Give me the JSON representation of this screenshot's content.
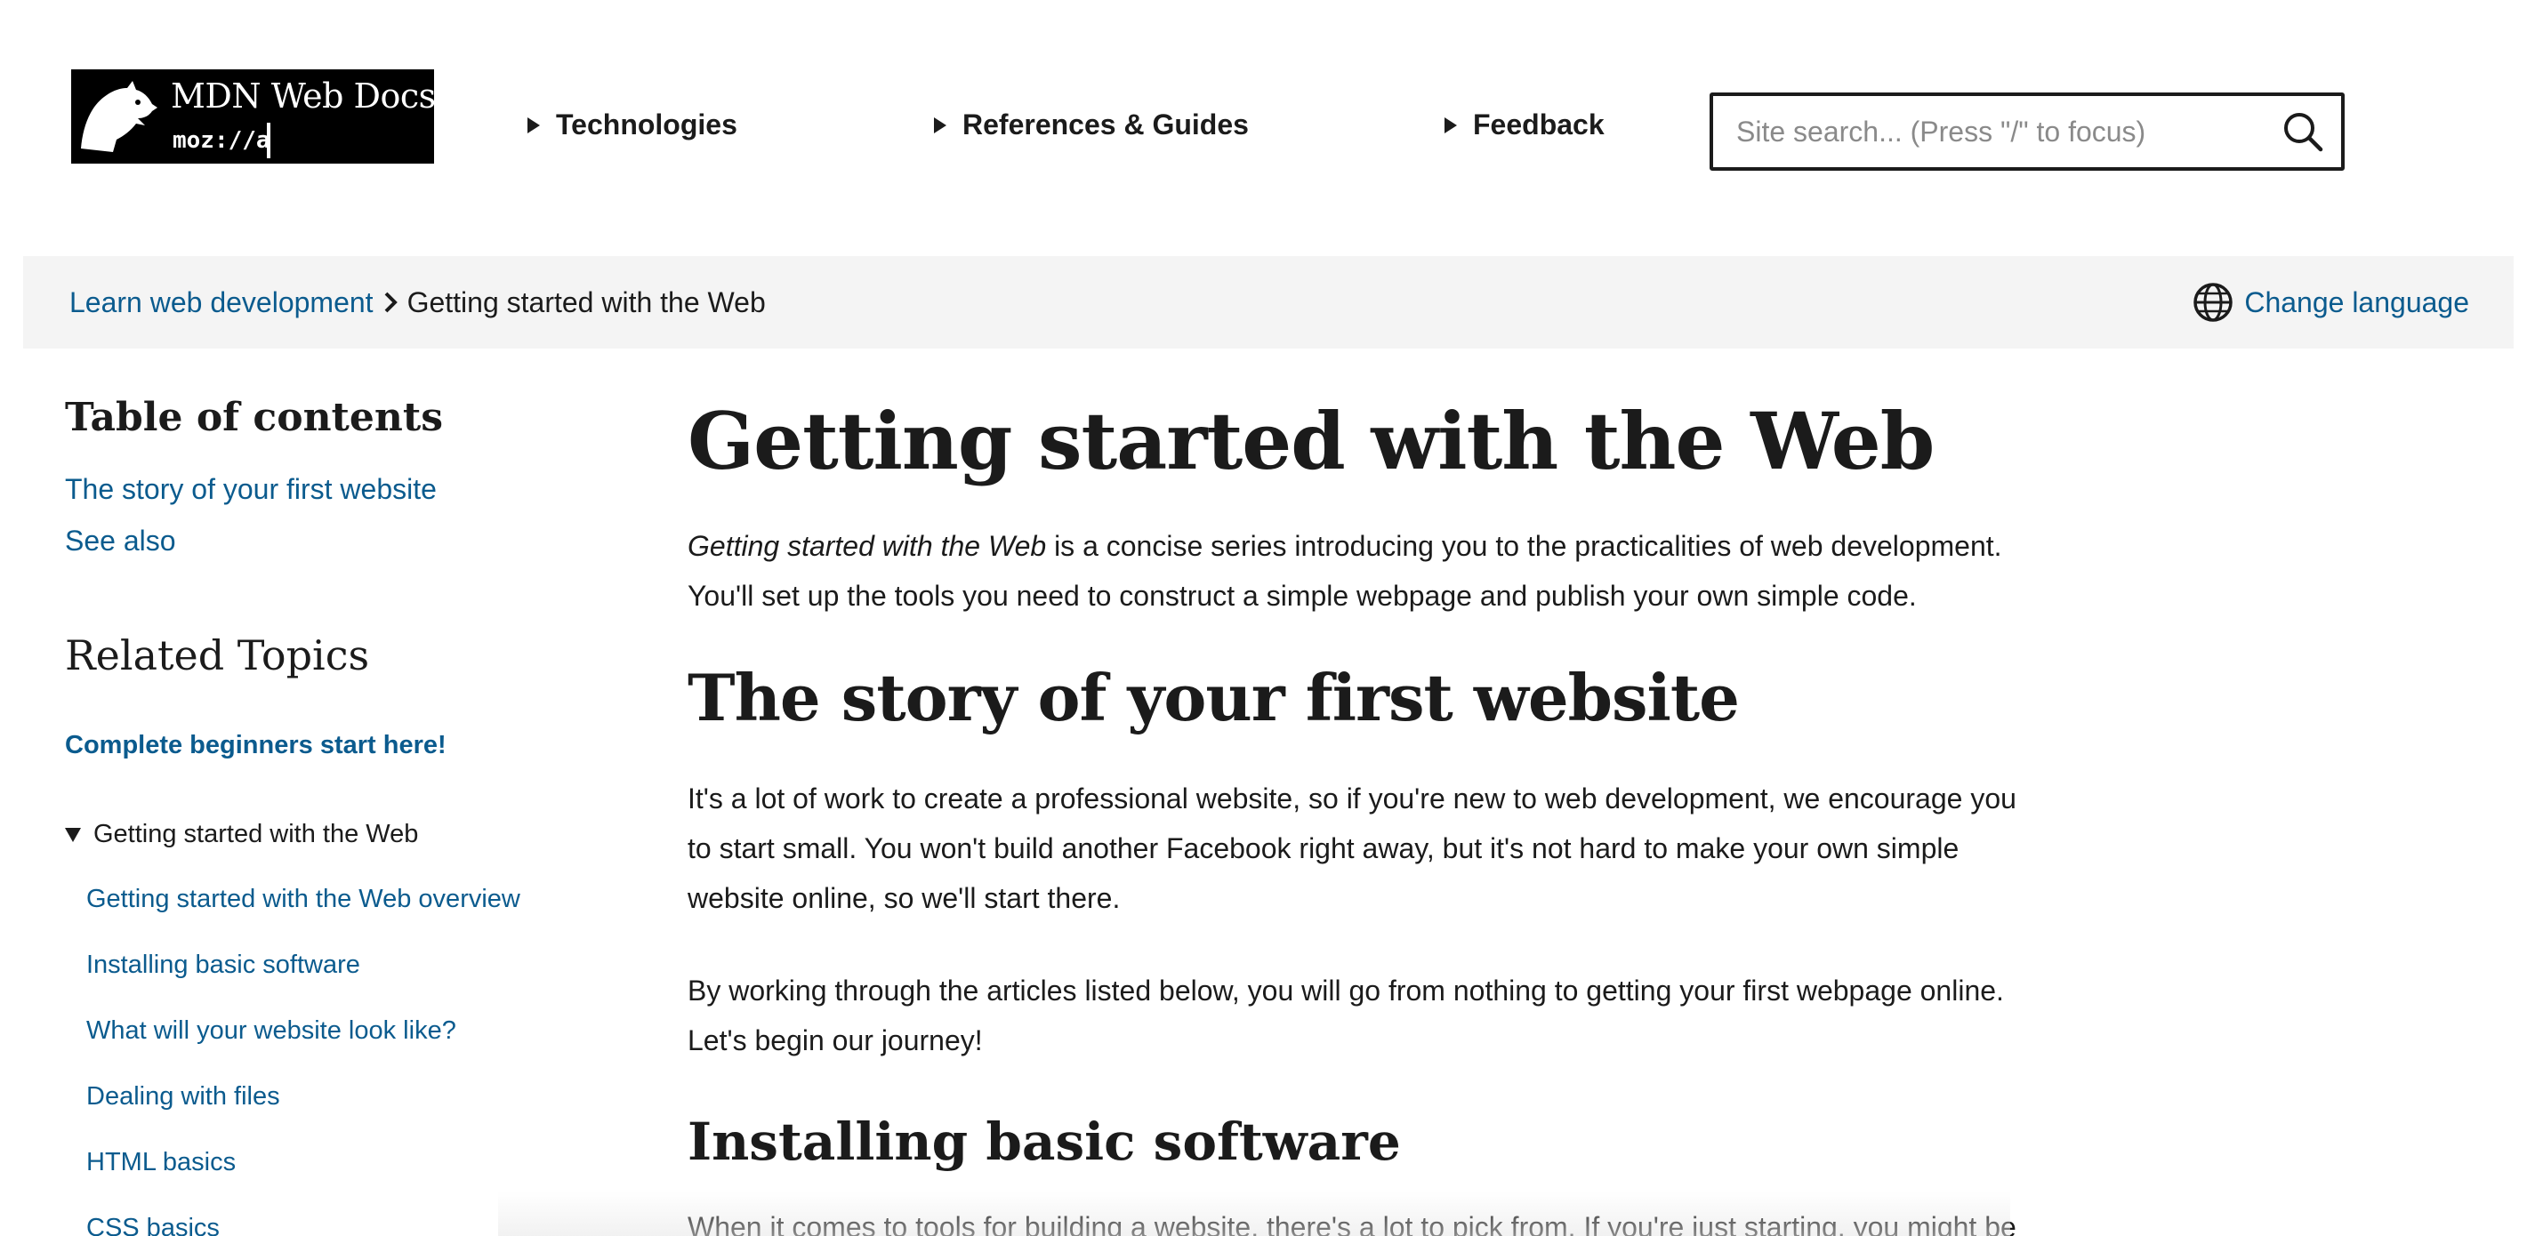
{
  "header": {
    "logo": {
      "title": "MDN Web Docs",
      "sub": "moz://a"
    },
    "nav": [
      {
        "label": "Technologies"
      },
      {
        "label": "References & Guides"
      },
      {
        "label": "Feedback"
      }
    ],
    "search": {
      "placeholder": "Site search... (Press \"/\" to focus)",
      "value": ""
    }
  },
  "breadcrumb": {
    "parent": "Learn web development",
    "current": "Getting started with the Web",
    "change_language": "Change language"
  },
  "sidebar": {
    "toc_title": "Table of contents",
    "toc": [
      {
        "label": "The story of your first website"
      },
      {
        "label": "See also"
      }
    ],
    "related_title": "Related Topics",
    "beginners_link": "Complete beginners start here!",
    "group": {
      "label": "Getting started with the Web",
      "expanded": true,
      "items": [
        {
          "label": "Getting started with the Web overview"
        },
        {
          "label": "Installing basic software"
        },
        {
          "label": "What will your website look like?"
        },
        {
          "label": "Dealing with files"
        },
        {
          "label": "HTML basics"
        },
        {
          "label": "CSS basics"
        }
      ]
    }
  },
  "main": {
    "title": "Getting started with the Web",
    "intro_em": "Getting started with the Web",
    "intro_rest": " is a concise series introducing you to the practicalities of web development. You'll set up the tools you need to construct a simple webpage and publish your own simple code.",
    "h2": "The story of your first website",
    "p1": "It's a lot of work to create a professional website, so if you're new to web development, we encourage you to start small. You won't build another Facebook right away, but it's not hard to make your own simple website online, so we'll start there.",
    "p2": "By working through the articles listed below,  you will go from nothing to getting your first webpage online. Let's begin our journey!",
    "h3": "Installing basic software",
    "p3": "When it comes to tools for building a website, there's a lot to pick from. If you're just starting, you might be"
  },
  "colors": {
    "link": "#0b5b8e",
    "text": "#1b1b1b",
    "bar": "#f4f4f4"
  },
  "icons": [
    "mdn-dino-logo",
    "search-icon",
    "chevron-right-icon",
    "globe-icon",
    "triangle-right-icon",
    "triangle-down-icon"
  ]
}
